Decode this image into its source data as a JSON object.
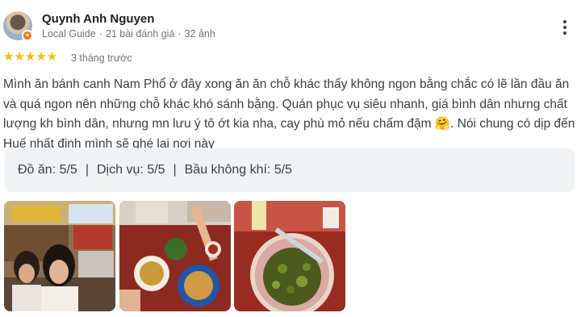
{
  "author": {
    "name": "Quynh Anh Nguyen",
    "local_guide": "Local Guide",
    "review_count": "21 bài đánh giá",
    "photo_count": "32 ảnh"
  },
  "review": {
    "stars": "★★★★★",
    "rating": 5,
    "time": "3 tháng trước",
    "text": "Mình ăn bánh canh Nam Phổ ở đây xong ăn ăn chỗ khác thấy không ngon bằng chắc có lẽ lần đầu ăn và quá ngon nên những chỗ khác khó sánh bằng. Quán phục vụ siêu nhanh, giá bình dân nhưng chất lượng kh bình dân, nhưng mn lưu ý tô ớt kia nha, cay phù mỏ nếu chấm đậm 🤗. Nói chung có dịp đến Huế nhất định mình sẽ ghé lại nơi này"
  },
  "ratings": {
    "food": "Đồ ăn: 5/5",
    "service": "Dịch vụ: 5/5",
    "atmosphere": "Bầu không khí: 5/5",
    "separator": "|"
  },
  "icons": {
    "more": "more-vert-icon",
    "badge": "local-guide-badge-icon"
  },
  "colors": {
    "star": "#fbbc04",
    "badge": "#e8710a",
    "rating_box": "#f1f3f4",
    "meta_text": "#70757a"
  }
}
